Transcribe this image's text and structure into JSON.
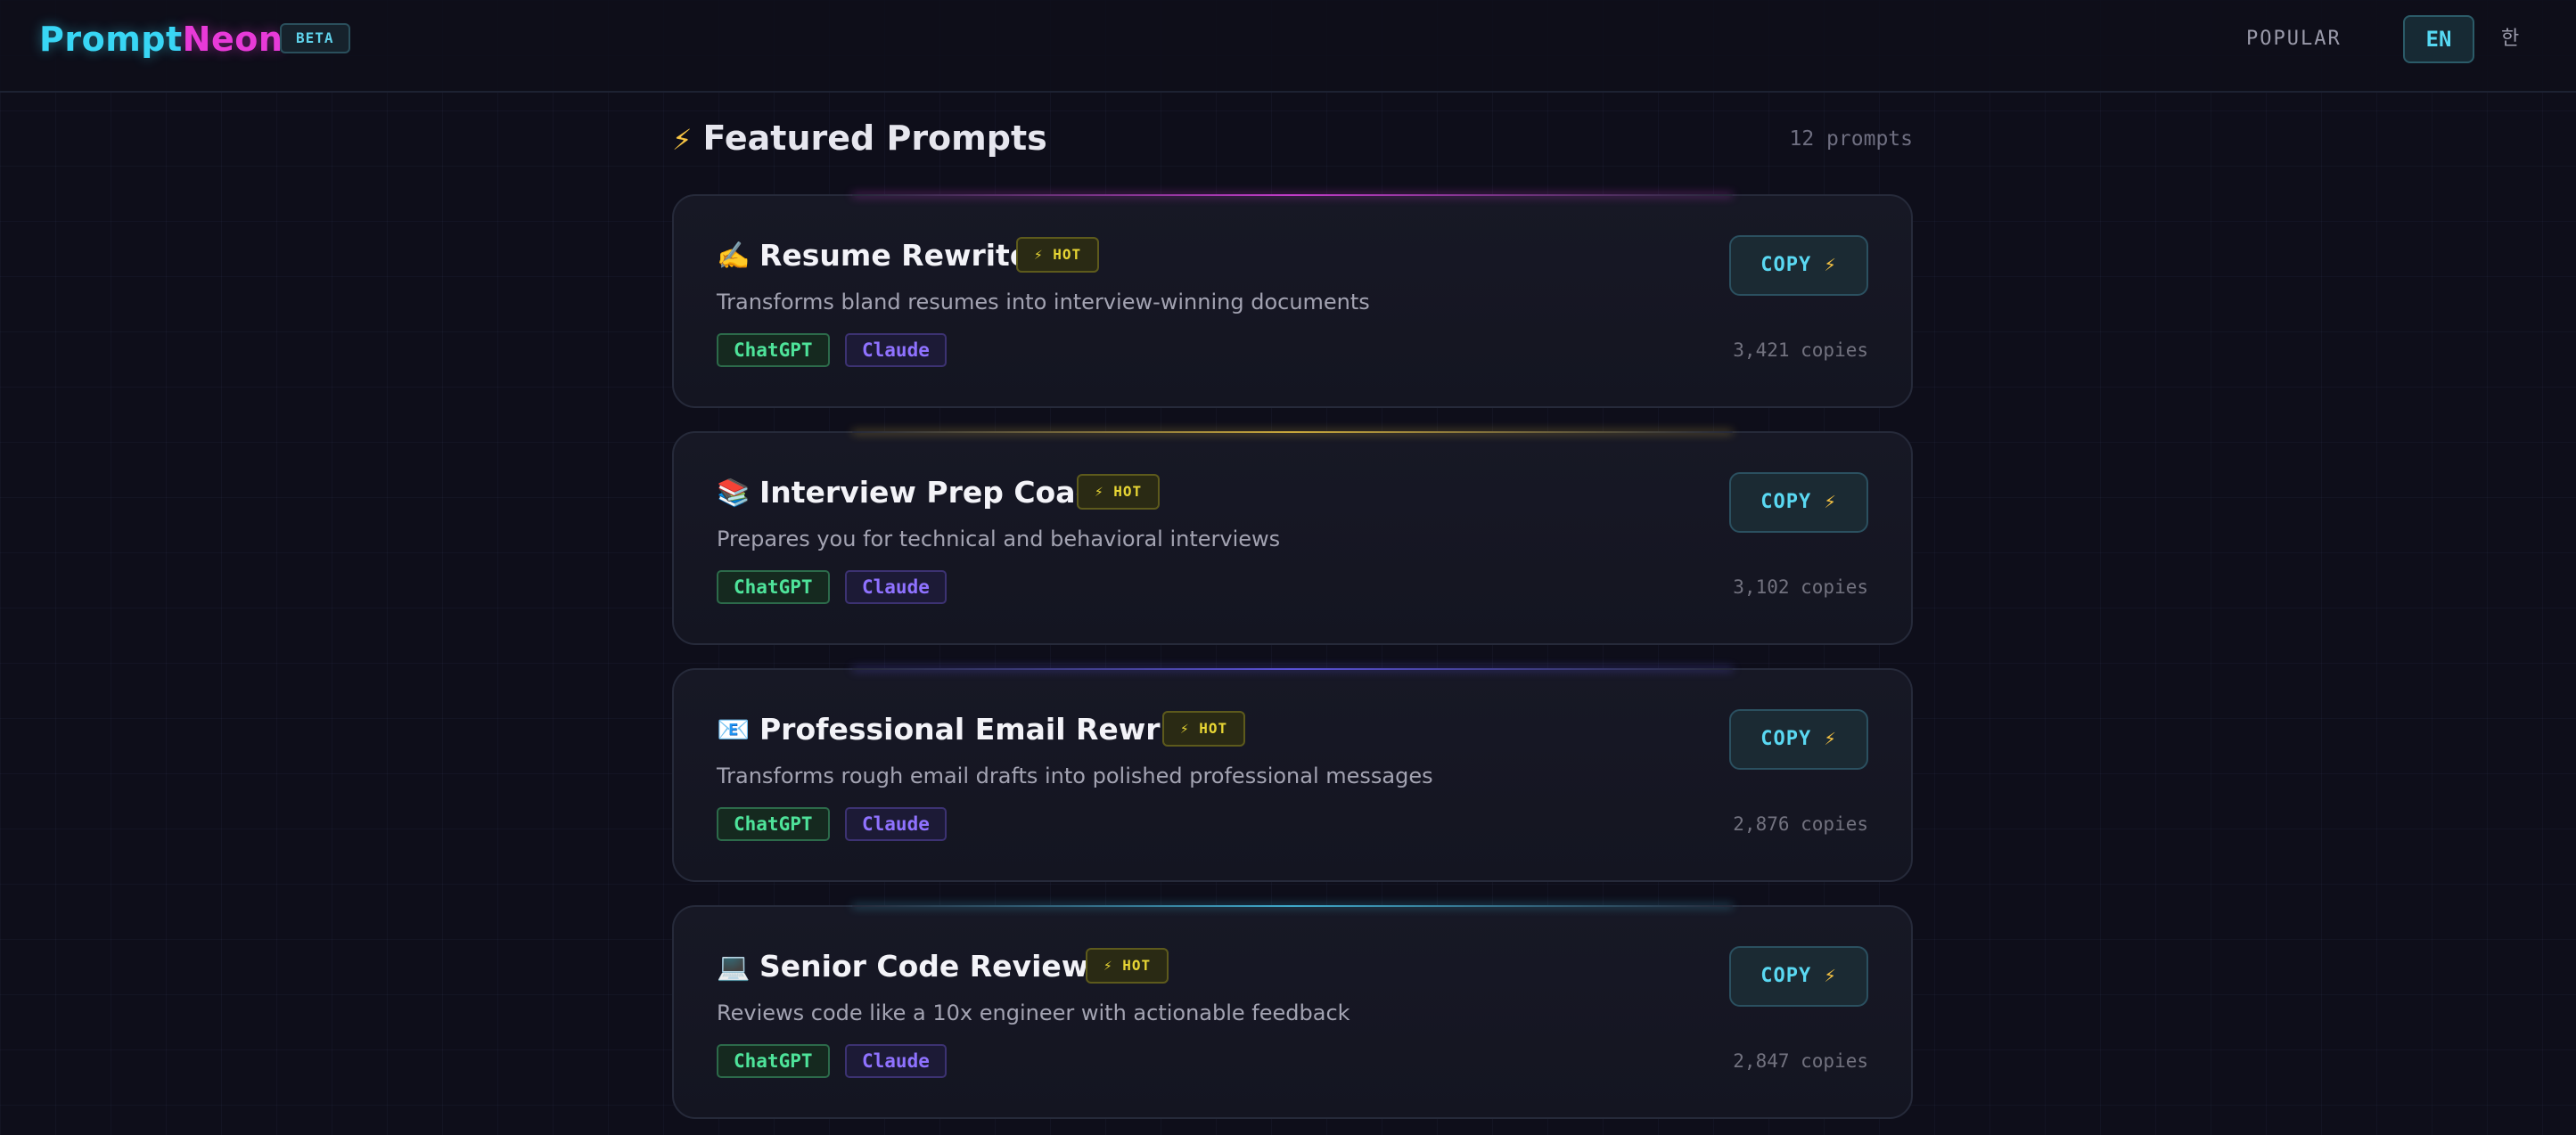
{
  "header": {
    "logo_part1": "Prompt",
    "logo_part2": "Neon",
    "badge": "BETA",
    "nav_popular": "POPULAR",
    "lang_en": "EN",
    "lang_ko": "한"
  },
  "section": {
    "icon": "⚡",
    "title": "Featured Prompts",
    "count": "12 prompts"
  },
  "cards": [
    {
      "emoji": "✍️",
      "title": "Resume Rewriter",
      "badge": "⚡ HOT",
      "description": "Transforms bland resumes into interview-winning documents",
      "tags": [
        "ChatGPT",
        "Claude"
      ],
      "copy_label": "COPY",
      "copy_icon": "⚡",
      "copies": "3,421 copies",
      "glow_color": "#c23cc8"
    },
    {
      "emoji": "📚",
      "title": "Interview Prep Coach",
      "badge": "⚡ HOT",
      "description": "Prepares you for technical and behavioral interviews",
      "tags": [
        "ChatGPT",
        "Claude"
      ],
      "copy_label": "COPY",
      "copy_icon": "⚡",
      "copies": "3,102 copies",
      "glow_color": "#c9a83c"
    },
    {
      "emoji": "📧",
      "title": "Professional Email Rewriter",
      "badge": "⚡ HOT",
      "description": "Transforms rough email drafts into polished professional messages",
      "tags": [
        "ChatGPT",
        "Claude"
      ],
      "copy_label": "COPY",
      "copy_icon": "⚡",
      "copies": "2,876 copies",
      "glow_color": "#5a52d6"
    },
    {
      "emoji": "💻",
      "title": "Senior Code Reviewer",
      "badge": "⚡ HOT",
      "description": "Reviews code like a 10x engineer with actionable feedback",
      "tags": [
        "ChatGPT",
        "Claude"
      ],
      "copy_label": "COPY",
      "copy_icon": "⚡",
      "copies": "2,847 copies",
      "glow_color": "#3fa8c9"
    }
  ]
}
